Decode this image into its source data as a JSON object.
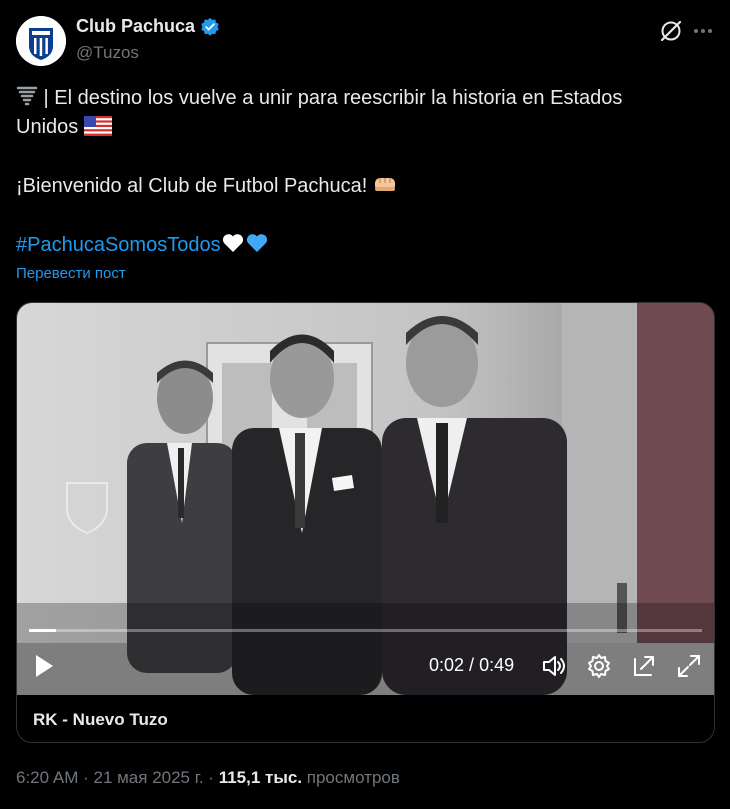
{
  "account": {
    "name": "Club Pachuca",
    "handle": "@Tuzos",
    "verified": true,
    "avatar_icon": "pachuca-crest-icon"
  },
  "post": {
    "line1": " | El destino los vuelve a unir para reescribir la historia en Estados",
    "line2": "Unidos",
    "line3": "¡Bienvenido al Club de Futbol Pachuca!",
    "hashtag": "#PachucaSomosTodos",
    "translate_label": "Перевести пост"
  },
  "video": {
    "current_time": "0:02",
    "separator": " / ",
    "duration": "0:49",
    "progress_fraction": 0.04,
    "caption": "RK - Nuevo Tuzo"
  },
  "meta": {
    "time": "6:20 AM",
    "dot": " · ",
    "date": "21 мая 2025 г.",
    "views_count": "115,1 тыс.",
    "views_label": " просмотров"
  },
  "colors": {
    "accent": "#1d9bf0",
    "background": "#000000",
    "text": "#e7e9ea",
    "muted": "#71767b"
  }
}
